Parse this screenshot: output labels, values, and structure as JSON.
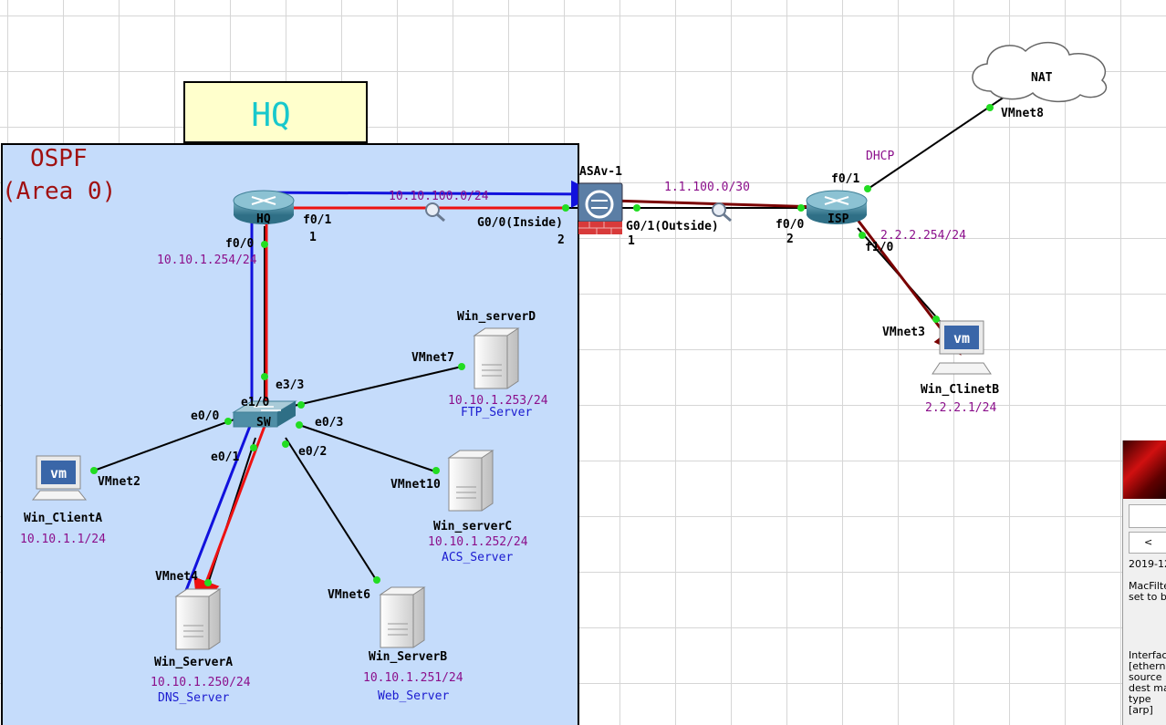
{
  "hq_label": "HQ",
  "ospf_area": {
    "line1": "OSPF",
    "line2": "(Area 0)"
  },
  "devices": {
    "hq_router": "HQ",
    "asa": "ASAv-1",
    "isp_router": "ISP",
    "nat_cloud": "NAT",
    "switch": "SW",
    "win_servera": "Win_ServerA",
    "win_serverb": "Win_ServerB",
    "win_serverc": "Win_serverC",
    "win_serverd": "Win_serverD",
    "win_clienta": "Win_ClientA",
    "win_clientb": "Win_ClinetB"
  },
  "networks": {
    "hq_asa": "10.10.100.0/24",
    "asa_isp": "1.1.100.0/30",
    "dhcp": "DHCP",
    "isp_lan": "2.2.2.254/24",
    "hq_lan": "10.10.1.254/24"
  },
  "interfaces": {
    "hq_f01": "f0/1",
    "hq_f01_n": "1",
    "hq_f00": "f0/0",
    "asa_inside": "G0/0(Inside)",
    "asa_inside_n": "2",
    "asa_outside": "G0/1(Outside)",
    "asa_outside_n": "1",
    "isp_f00": "f0/0",
    "isp_f00_n": "2",
    "isp_f01": "f0/1",
    "isp_f10": "f1/0",
    "sw_e33": "e3/3",
    "sw_e10": "e1/0",
    "sw_e00": "e0/0",
    "sw_e01": "e0/1",
    "sw_e03": "e0/3",
    "sw_e02": "e0/2",
    "vmnet8": "VMnet8",
    "vmnet3": "VMnet3",
    "vmnet7": "VMnet7",
    "vmnet10": "VMnet10",
    "vmnet2": "VMnet2",
    "vmnet4": "VMnet4",
    "vmnet6": "VMnet6"
  },
  "hosts": {
    "serverd_ip": "10.10.1.253/24",
    "serverd_role": "FTP_Server",
    "serverc_ip": "10.10.1.252/24",
    "serverc_role": "ACS_Server",
    "servera_ip": "10.10.1.250/24",
    "servera_role": "DNS_Server",
    "serverb_ip": "10.10.1.251/24",
    "serverb_role": "Web_Server",
    "clienta_ip": "10.10.1.1/24",
    "clientb_ip": "2.2.2.1/24",
    "vm_badge": "vm"
  },
  "side_panel": {
    "nav": "<",
    "date": "2019-12",
    "line1": "MacFilte",
    "line2": "set to b",
    "line3": "Interfac",
    "line4": "[ethern",
    "line5": "source",
    "line6": "dest ma",
    "line7": "type",
    "line8": "[arp]"
  },
  "colors": {
    "area_fill": "#c5dcfb",
    "hq_box": "#ffffcc",
    "trace_red": "#ee1111",
    "trace_blue": "#1111dd",
    "trace_dark": "#7a0000",
    "ip_text": "#8b0f8b",
    "svc_text": "#1a1ad0"
  }
}
